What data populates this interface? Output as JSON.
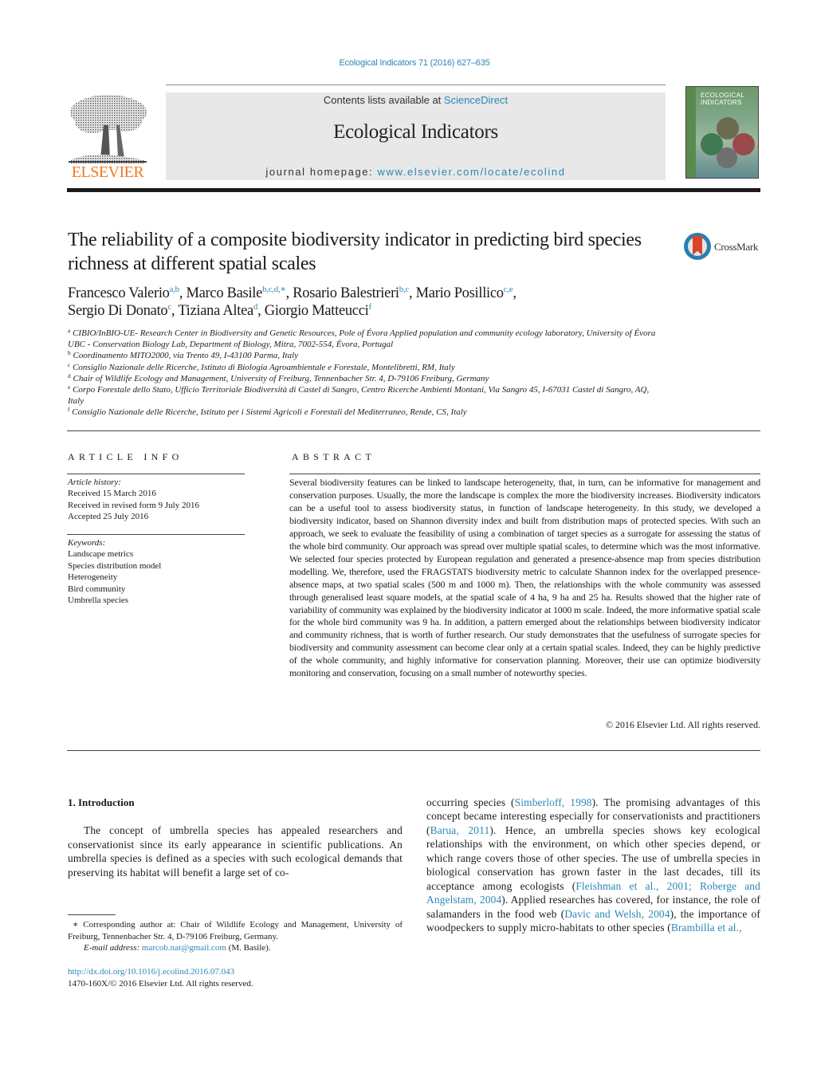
{
  "header": {
    "journal_reference": "Ecological Indicators 71 (2016) 627–635",
    "contents_prefix": "Contents lists available at ",
    "contents_link": "ScienceDirect",
    "journal_name": "Ecological Indicators",
    "homepage_prefix": "journal homepage: ",
    "homepage_link": "www.elsevier.com/locate/ecolind",
    "publisher_logo_text": "ELSEVIER",
    "cover_title_line1": "ECOLOGICAL",
    "cover_title_line2": "INDICATORS",
    "brand_colors": {
      "elsevier_orange": "#f47920",
      "link_blue": "#2a87b5",
      "crossmark_red": "#d9442b"
    }
  },
  "article": {
    "title": "The reliability of a composite biodiversity indicator in predicting bird species richness at different spatial scales",
    "crossmark_label": "CrossMark",
    "authors": [
      {
        "name": "Francesco Valerio",
        "affil": "a,b",
        "sep": ", "
      },
      {
        "name": "Marco Basile",
        "affil": "b,c,d,∗",
        "sep": ", "
      },
      {
        "name": "Rosario Balestrieri",
        "affil": "b,c",
        "sep": ", "
      },
      {
        "name": "Mario Posillico",
        "affil": "c,e",
        "sep": ","
      },
      {
        "name": "Sergio Di Donato",
        "affil": "c",
        "sep": ", "
      },
      {
        "name": "Tiziana Altea",
        "affil": "d",
        "sep": ", "
      },
      {
        "name": "Giorgio Matteucci",
        "affil": "f",
        "sep": ""
      }
    ],
    "affiliations": [
      {
        "key": "a",
        "text": "CIBIO/InBIO-UE- Research Center in Biodiversity and Genetic Resources, Pole of Évora Applied population and community ecology laboratory, University of Évora UBC - Conservation Biology Lab, Department of Biology, Mitra, 7002-554, Évora, Portugal"
      },
      {
        "key": "b",
        "text": "Coordinamento MITO2000, via Trento 49, I-43100 Parma, Italy"
      },
      {
        "key": "c",
        "text": "Consiglio Nazionale delle Ricerche, Istituto di Biologia Agroambientale e Forestale, Montelibretti, RM, Italy"
      },
      {
        "key": "d",
        "text": "Chair of Wildlife Ecology and Management, University of Freiburg, Tennenbacher Str. 4, D-79106 Freiburg, Germany"
      },
      {
        "key": "e",
        "text": "Corpo Forestale dello Stato, Ufficio Territoriale Biodiversità di Castel di Sangro, Centro Ricerche Ambienti Montani, Via Sangro 45, I-67031 Castel di Sangro, AQ, Italy"
      },
      {
        "key": "f",
        "text": "Consiglio Nazionale delle Ricerche, Istituto per i Sistemi Agricoli e Forestali del Mediterraneo, Rende, CS, Italy"
      }
    ]
  },
  "article_info": {
    "heading": "ARTICLE INFO",
    "history_label": "Article history:",
    "history": [
      "Received 15 March 2016",
      "Received in revised form 9 July 2016",
      "Accepted 25 July 2016"
    ],
    "keywords_label": "Keywords:",
    "keywords": [
      "Landscape metrics",
      "Species distribution model",
      "Heterogeneity",
      "Bird community",
      "Umbrella species"
    ]
  },
  "abstract": {
    "heading": "ABSTRACT",
    "text": "Several biodiversity features can be linked to landscape heterogeneity, that, in turn, can be informative for management and conservation purposes. Usually, the more the landscape is complex the more the biodiversity increases. Biodiversity indicators can be a useful tool to assess biodiversity status, in function of landscape heterogeneity. In this study, we developed a biodiversity indicator, based on Shannon diversity index and built from distribution maps of protected species. With such an approach, we seek to evaluate the feasibility of using a combination of target species as a surrogate for assessing the status of the whole bird community. Our approach was spread over multiple spatial scales, to determine which was the most informative. We selected four species protected by European regulation and generated a presence-absence map from species distribution modelling. We, therefore, used the FRAGSTATS biodiversity metric to calculate Shannon index for the overlapped presence-absence maps, at two spatial scales (500 m and 1000 m). Then, the relationships with the whole community was assessed through generalised least square models, at the spatial scale of 4 ha, 9 ha and 25 ha. Results showed that the higher rate of variability of community was explained by the biodiversity indicator at 1000 m scale. Indeed, the more informative spatial scale for the whole bird community was 9 ha. In addition, a pattern emerged about the relationships between biodiversity indicator and community richness, that is worth of further research. Our study demonstrates that the usefulness of surrogate species for biodiversity and community assessment can become clear only at a certain spatial scales. Indeed, they can be highly predictive of the whole community, and highly informative for conservation planning. Moreover, their use can optimize biodiversity monitoring and conservation, focusing on a small number of noteworthy species.",
    "copyright": "© 2016 Elsevier Ltd. All rights reserved."
  },
  "body": {
    "section_heading": "1.  Introduction",
    "left_paragraph": "The concept of umbrella species has appealed researchers and conservationist since its early appearance in scientific publications. An umbrella species is defined as a species with such ecological demands that preserving its habitat will benefit a large set of co-",
    "right_segments": [
      {
        "t": "occurring species (",
        "link": false
      },
      {
        "t": "Simberloff, 1998",
        "link": true
      },
      {
        "t": "). The promising advantages of this concept became interesting especially for conservationists and practitioners (",
        "link": false
      },
      {
        "t": "Barua, 2011",
        "link": true
      },
      {
        "t": "). Hence, an umbrella species shows key ecological relationships with the environment, on which other species depend, or which range covers those of other species. The use of umbrella species in biological conservation has grown faster in the last decades, till its acceptance among ecologists (",
        "link": false
      },
      {
        "t": "Fleishman et al., 2001; Roberge and Angelstam, 2004",
        "link": true
      },
      {
        "t": "). Applied researches has covered, for instance, the role of salamanders in the food web (",
        "link": false
      },
      {
        "t": "Davic and Welsh, 2004",
        "link": true
      },
      {
        "t": "), the importance of woodpeckers to supply micro-habitats to other species (",
        "link": false
      },
      {
        "t": "Brambilla et al.,",
        "link": true
      }
    ]
  },
  "footnotes": {
    "corresponding": "∗  Corresponding author at: Chair of Wildlife Ecology and Management, University of Freiburg, Tennenbacher Str. 4, D-79106 Freiburg, Germany.",
    "email_label": "E-mail address: ",
    "email": "marcob.nat@gmail.com",
    "email_suffix": " (M. Basile).",
    "doi": "http://dx.doi.org/10.1016/j.ecolind.2016.07.043",
    "issn_copyright": "1470-160X/© 2016 Elsevier Ltd. All rights reserved."
  }
}
